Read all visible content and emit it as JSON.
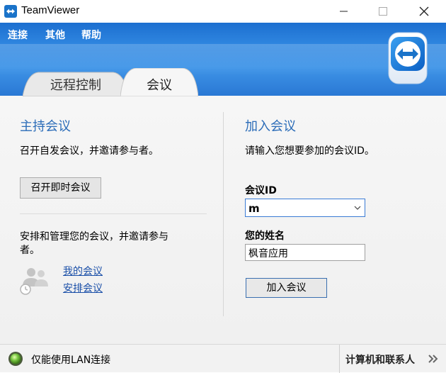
{
  "window": {
    "title": "TeamViewer"
  },
  "menu": {
    "items": [
      "连接",
      "其他",
      "帮助"
    ]
  },
  "tabs": [
    {
      "label": "远程控制",
      "active": false
    },
    {
      "label": "会议",
      "active": true
    }
  ],
  "host": {
    "title": "主持会议",
    "description": "召开自发会议，并邀请参与者。",
    "instant_button": "召开即时会议",
    "schedule_text_line1": "安排和管理您的会议，并邀请参与",
    "schedule_text_line2": "者。",
    "link_my_meetings": "我的会议",
    "link_schedule": "安排会议"
  },
  "join": {
    "title": "加入会议",
    "description": "请输入您想要参加的会议ID。",
    "id_label": "会议ID",
    "id_value": "m",
    "name_label": "您的姓名",
    "name_value": "枫音应用",
    "join_button": "加入会议"
  },
  "status": {
    "text": "仅能使用LAN连接",
    "contacts_label": "计算机和联系人"
  },
  "colors": {
    "accent": "#2b6cb8",
    "banner": "#2f86e0",
    "status_led": "#7ac943"
  }
}
